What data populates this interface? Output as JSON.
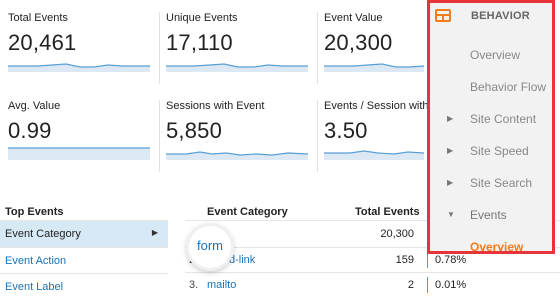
{
  "metrics": [
    {
      "label": "Total Events",
      "value": "20,461"
    },
    {
      "label": "Unique Events",
      "value": "17,110"
    },
    {
      "label": "Event Value",
      "value": "20,300"
    },
    {
      "label": "Avg. Value",
      "value": "0.99"
    },
    {
      "label": "Sessions with Event",
      "value": "5,850"
    },
    {
      "label": "Events / Session with Event",
      "value": "3.50"
    }
  ],
  "top_events": {
    "title": "Top Events",
    "items": [
      {
        "label": "Event Category",
        "active": true
      },
      {
        "label": "Event Action",
        "active": false
      },
      {
        "label": "Event Label",
        "active": false
      }
    ]
  },
  "table": {
    "headers": {
      "category": "Event Category",
      "total": "Total Events"
    },
    "rows": [
      {
        "num": "",
        "category": "",
        "total": "20,300",
        "pct": ""
      },
      {
        "num": "2.",
        "category": "d-link",
        "total": "159",
        "pct": "0.78%"
      },
      {
        "num": "3.",
        "category": "mailto",
        "total": "2",
        "pct": "0.01%"
      }
    ]
  },
  "zoom_label": "form",
  "menu": {
    "title": "BEHAVIOR",
    "accent": "#f07c1b",
    "border": "#e5353a",
    "items": [
      {
        "label": "Overview",
        "arrow": ""
      },
      {
        "label": "Behavior Flow",
        "arrow": ""
      },
      {
        "label": "Site Content",
        "arrow": "▶"
      },
      {
        "label": "Site Speed",
        "arrow": "▶"
      },
      {
        "label": "Site Search",
        "arrow": "▶"
      },
      {
        "label": "Events",
        "arrow": "▼"
      },
      {
        "label": "Overview",
        "arrow": ""
      }
    ]
  },
  "icons": {
    "behavior": "behavior-window-icon",
    "expand": "chevron-right-icon"
  }
}
